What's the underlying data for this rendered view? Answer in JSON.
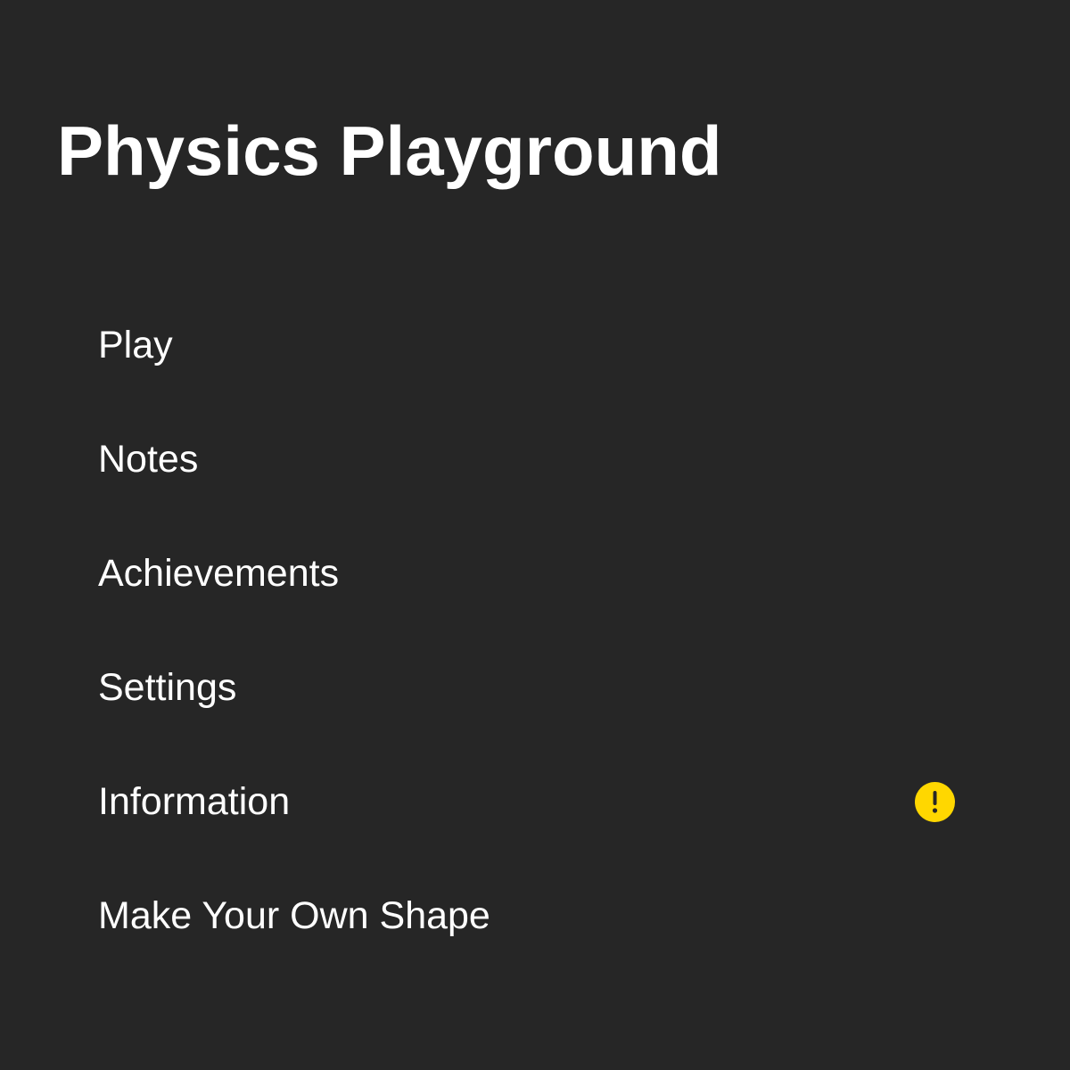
{
  "app": {
    "title": "Physics Playground"
  },
  "menu": {
    "items": [
      {
        "label": "Play"
      },
      {
        "label": "Notes"
      },
      {
        "label": "Achievements"
      },
      {
        "label": "Settings"
      },
      {
        "label": "Information",
        "badge_icon": "exclamation-circle-icon"
      },
      {
        "label": "Make Your Own Shape"
      }
    ]
  },
  "colors": {
    "background": "#262626",
    "text": "#ffffff",
    "alert": "#ffd700"
  }
}
